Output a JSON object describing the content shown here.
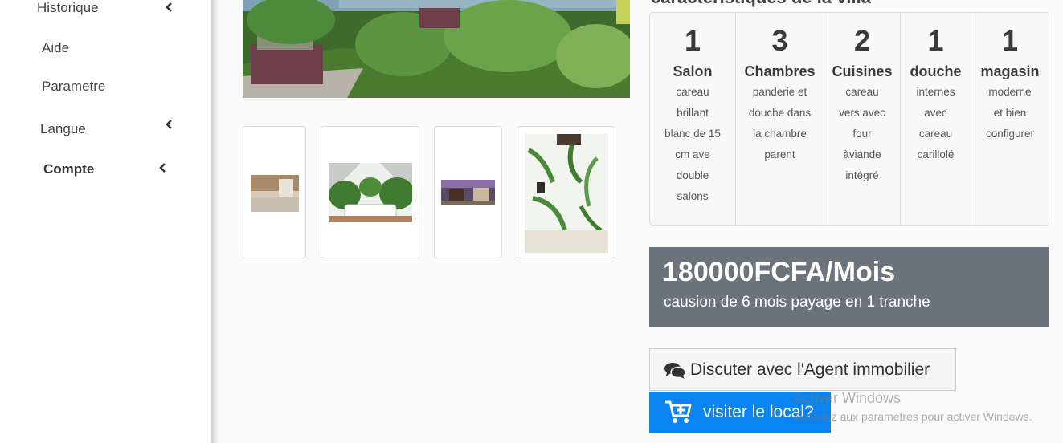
{
  "sidebar": {
    "items": [
      {
        "label": "Historique",
        "has_chevron": true
      },
      {
        "label": "Aide",
        "has_chevron": false
      },
      {
        "label": "Parametre",
        "has_chevron": false
      },
      {
        "label": "Langue",
        "has_chevron": true
      },
      {
        "label": "Compte",
        "has_chevron": true
      }
    ]
  },
  "features": {
    "title": "caractéristiques de la villa",
    "columns": [
      {
        "count": "1",
        "name": "Salon",
        "desc_lines": [
          "careau",
          "brillant",
          "blanc de 15",
          "cm ave",
          "double",
          "salons"
        ]
      },
      {
        "count": "3",
        "name": "Chambres",
        "desc_lines": [
          "panderie et",
          "douche dans",
          "la chambre",
          "parent"
        ]
      },
      {
        "count": "2",
        "name": "Cuisines",
        "desc_lines": [
          "careau",
          "vers avec",
          "four",
          "àviande",
          "intégré"
        ]
      },
      {
        "count": "1",
        "name": "douche",
        "desc_lines": [
          "internes",
          "avec",
          "careau",
          "carillolé"
        ]
      },
      {
        "count": "1",
        "name": "magasin",
        "desc_lines": [
          "moderne",
          "et bien",
          "configurer"
        ]
      }
    ]
  },
  "price": {
    "amount": "180000FCFA/Mois",
    "subtitle": "causion de 6 mois payage en 1 tranche"
  },
  "actions": {
    "chat_label": "Discuter avec l'Agent immobilier",
    "visit_label": "visiter le local?"
  },
  "watermark": {
    "line1": "Activer Windows",
    "line2": "Accédez aux paramètres pour activer Windows."
  },
  "colors": {
    "price_bg": "#6b747c",
    "visit_btn": "#0a84f0"
  }
}
